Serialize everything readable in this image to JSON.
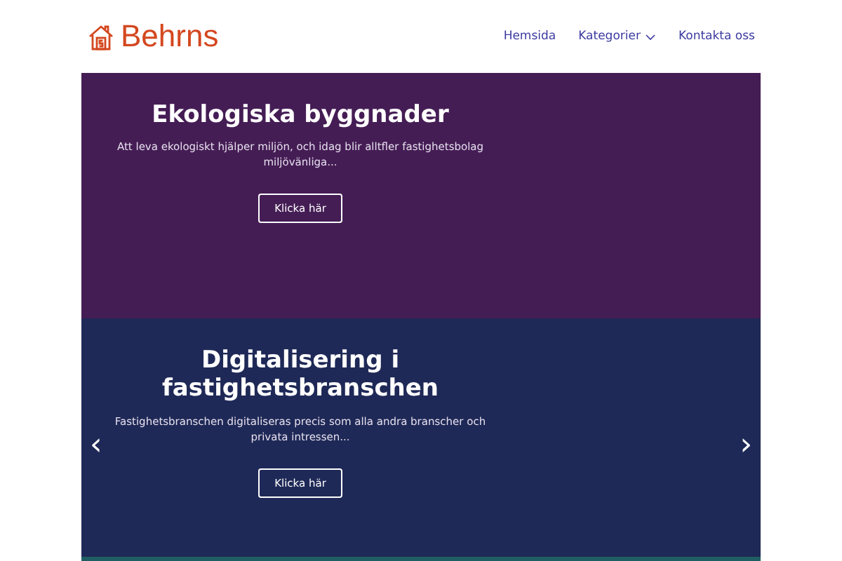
{
  "brand": {
    "name": "Behrns"
  },
  "nav": [
    {
      "label": "Hemsida",
      "kind": "link"
    },
    {
      "label": "Kategorier",
      "kind": "dropdown"
    },
    {
      "label": "Kontakta oss",
      "kind": "link"
    }
  ],
  "sections": [
    {
      "title": "Ekologiska byggnader",
      "text": "Att leva ekologiskt hjälper miljön, och idag blir alltfler fastighetsbolag miljövänliga...",
      "button": "Klicka här",
      "color": "#451d55"
    },
    {
      "title": "Digitalisering i fastighetsbranschen",
      "text": "Fastighetsbranschen digitaliseras precis som alla andra branscher och privata intressen...",
      "button": "Klicka här",
      "color": "#1f2957"
    },
    {
      "color": "#1f5f63"
    }
  ],
  "carousel": {
    "prev": "‹",
    "next": "›"
  }
}
